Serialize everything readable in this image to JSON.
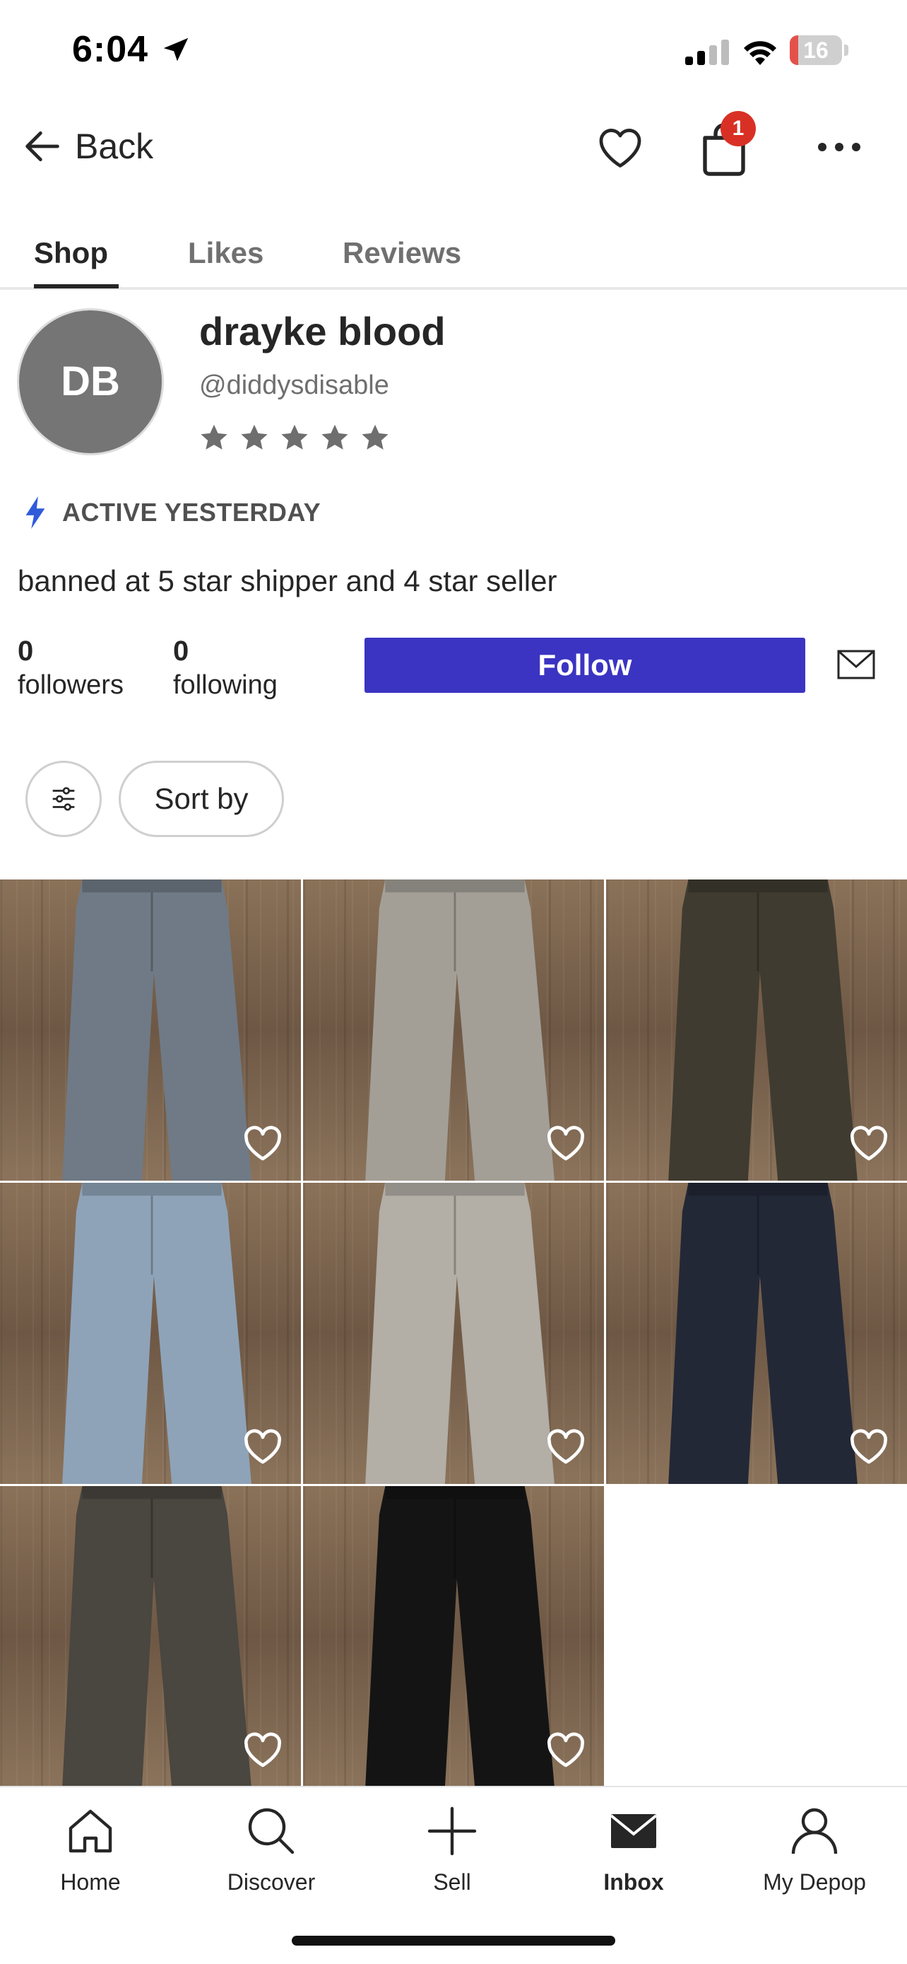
{
  "status_bar": {
    "time": "6:04",
    "battery": "16",
    "battery_level": 0.16
  },
  "nav": {
    "back_label": "Back",
    "cart_count": "1"
  },
  "tabs": [
    {
      "label": "Shop",
      "active": true
    },
    {
      "label": "Likes",
      "active": false
    },
    {
      "label": "Reviews",
      "active": false
    }
  ],
  "profile": {
    "initials": "DB",
    "display_name": "drayke blood",
    "username": "@diddysdisable",
    "rating": 0,
    "max_rating": 5,
    "activity": "ACTIVE YESTERDAY",
    "bio": "banned at 5 star shipper and 4 star seller",
    "followers_count": "0",
    "followers_label": "followers",
    "following_count": "0",
    "following_label": "following",
    "follow_label": "Follow"
  },
  "filters": {
    "sort_label": "Sort by"
  },
  "listings": [
    {
      "item": "light wash flared jeans",
      "color": "#6f7a86"
    },
    {
      "item": "grey cargo zip-off pants",
      "color": "#a39f97"
    },
    {
      "item": "dark brown corduroy pants",
      "color": "#3f3b30"
    },
    {
      "item": "distressed light wash jeans",
      "color": "#8ea3b8"
    },
    {
      "item": "grey sweatpants",
      "color": "#b3aea6"
    },
    {
      "item": "dark denim flare jeans",
      "color": "#232836"
    },
    {
      "item": "faded black cargo pants",
      "color": "#4a4640"
    },
    {
      "item": "black zip flare pants",
      "color": "#141414"
    }
  ],
  "tabbar": {
    "home": "Home",
    "discover": "Discover",
    "sell": "Sell",
    "inbox": "Inbox",
    "my_depop": "My Depop",
    "active": "inbox"
  },
  "colors": {
    "accent": "#3b34c2",
    "badge": "#d93025",
    "text": "#262626",
    "muted": "#6f6f6f",
    "active_icon": "#2f5bdb"
  }
}
